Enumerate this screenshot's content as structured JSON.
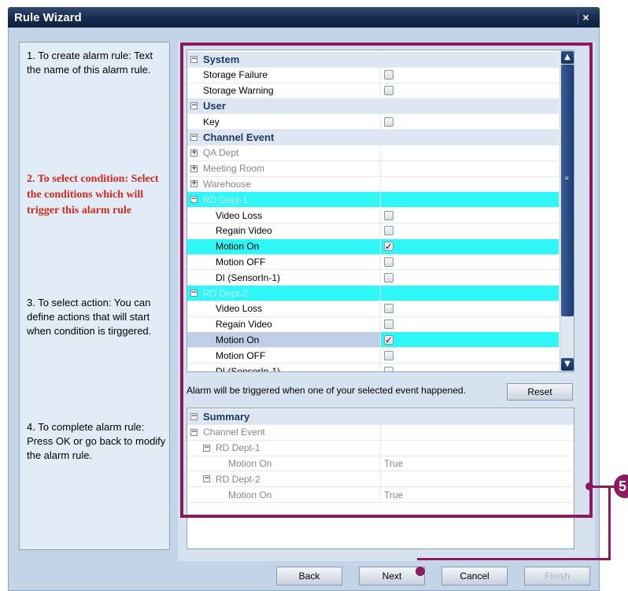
{
  "window": {
    "title": "Rule Wizard",
    "close_label": "×"
  },
  "steps": [
    {
      "text": "1. To create alarm rule: Text the name of this alarm rule."
    },
    {
      "text": "2. To select condition: Select the conditions which will trigger this alarm rule"
    },
    {
      "text": "3. To select action: You can define actions that will start when condition is tirggered."
    },
    {
      "text": "4. To complete alarm rule: Press OK or go back to modify the alarm rule."
    }
  ],
  "event_grid": {
    "rows": [
      {
        "label": "System",
        "type": "cat",
        "expander": "−"
      },
      {
        "label": "Storage Failure",
        "type": "item",
        "checked": false
      },
      {
        "label": "Storage Warning",
        "type": "item",
        "checked": false
      },
      {
        "label": "User",
        "type": "cat",
        "expander": "−"
      },
      {
        "label": "Key",
        "type": "item",
        "checked": false
      },
      {
        "label": "Channel Event",
        "type": "cat",
        "expander": "−"
      },
      {
        "label": "QA Dept",
        "type": "sub",
        "expander": "+"
      },
      {
        "label": "Meeting Room",
        "type": "sub",
        "expander": "+"
      },
      {
        "label": "Warehouse",
        "type": "sub",
        "expander": "+"
      },
      {
        "label": "RD Dept-1",
        "type": "dept",
        "expander": "−"
      },
      {
        "label": "Video Loss",
        "type": "item2",
        "checked": false
      },
      {
        "label": "Regain Video",
        "type": "item2",
        "checked": false
      },
      {
        "label": "Motion On",
        "type": "item2",
        "checked": true,
        "highlight": "sel"
      },
      {
        "label": "Motion OFF",
        "type": "item2",
        "checked": false
      },
      {
        "label": "DI (SensorIn-1)",
        "type": "item2",
        "checked": false
      },
      {
        "label": "RD Dept-2",
        "type": "dept",
        "expander": "−"
      },
      {
        "label": "Video Loss",
        "type": "item2",
        "checked": false
      },
      {
        "label": "Regain Video",
        "type": "item2",
        "checked": false
      },
      {
        "label": "Motion On",
        "type": "item2",
        "checked": true,
        "highlight": "sel2"
      },
      {
        "label": "Motion OFF",
        "type": "item2",
        "checked": false
      },
      {
        "label": "DI (SensorIn-1)",
        "type": "item2",
        "checked": false
      }
    ],
    "check_mark": "✓",
    "scroll_up": "▲",
    "scroll_down": "▼",
    "thumb_grip": "≡"
  },
  "hint_text": "Alarm will be triggered when one of your selected event happened.",
  "reset_label": "Reset",
  "summary": {
    "rows": [
      {
        "label": "Summary",
        "type": "cat",
        "expander": "−",
        "value": ""
      },
      {
        "label": "Channel Event",
        "type": "sub",
        "expander": "−",
        "value": ""
      },
      {
        "label": "RD Dept-1",
        "type": "sub1",
        "expander": "−",
        "value": ""
      },
      {
        "label": "Motion On",
        "type": "sub2",
        "expander": "",
        "value": "True"
      },
      {
        "label": "RD Dept-2",
        "type": "sub1",
        "expander": "−",
        "value": ""
      },
      {
        "label": "Motion On",
        "type": "sub2",
        "expander": "",
        "value": "True"
      }
    ]
  },
  "buttons": {
    "back": "Back",
    "next": "Next",
    "cancel": "Cancel",
    "finish": "Finish"
  },
  "annotation": {
    "badge": "5"
  },
  "colors": {
    "highlight": "#2ff7f7",
    "annotation": "#8b1a5e",
    "active_step": "#d4281e"
  }
}
